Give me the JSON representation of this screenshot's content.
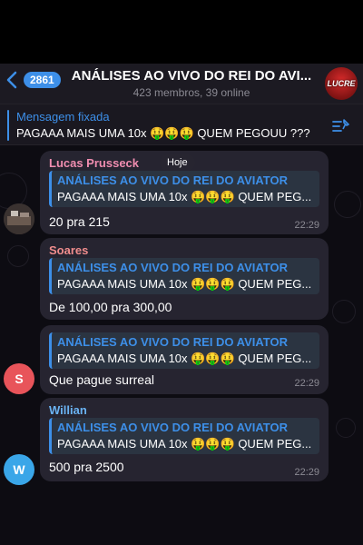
{
  "header": {
    "badge_count": "2861",
    "title": "ANÁLISES AO VIVO DO REI DO AVI...",
    "subtitle": "423 membros, 39 online",
    "avatar_text": "LUCRE"
  },
  "pinned": {
    "title": "Mensagem fixada",
    "text": "PAGAAA MAIS UMA 10x 🤑🤑🤑 QUEM PEGOUU ???"
  },
  "chat": {
    "date_chip": "Hoje",
    "messages": [
      {
        "sender": "Lucas Prusseck",
        "sender_color": "#f08db0",
        "reply_title": "ANÁLISES AO VIVO DO REI DO AVIATOR",
        "reply_text": "PAGAAA MAIS UMA 10x 🤑🤑🤑 QUEM PEG...",
        "text": "20 pra 215",
        "time": "22:29"
      },
      {
        "sender": "Soares",
        "sender_color": "#f08d8d",
        "reply_title": "ANÁLISES AO VIVO DO REI DO AVIATOR",
        "reply_text": "PAGAAA MAIS UMA 10x 🤑🤑🤑 QUEM PEG...",
        "text": "De 100,00 pra 300,00",
        "time": ""
      },
      {
        "sender": "",
        "reply_title": "ANÁLISES AO VIVO DO REI DO AVIATOR",
        "reply_text": "PAGAAA MAIS UMA 10x 🤑🤑🤑 QUEM PEG...",
        "text": "Que pague surreal",
        "time": "22:29",
        "avatar_letter": "S",
        "avatar_color": "#e8545a"
      },
      {
        "sender": "Willian",
        "sender_color": "#6ab3f3",
        "reply_title": "ANÁLISES AO VIVO DO REI DO AVIATOR",
        "reply_text": "PAGAAA MAIS UMA 10x 🤑🤑🤑 QUEM PEG...",
        "text": "500 pra 2500",
        "time": "22:29",
        "avatar_letter": "W",
        "avatar_color": "#3aa6e8"
      }
    ]
  }
}
